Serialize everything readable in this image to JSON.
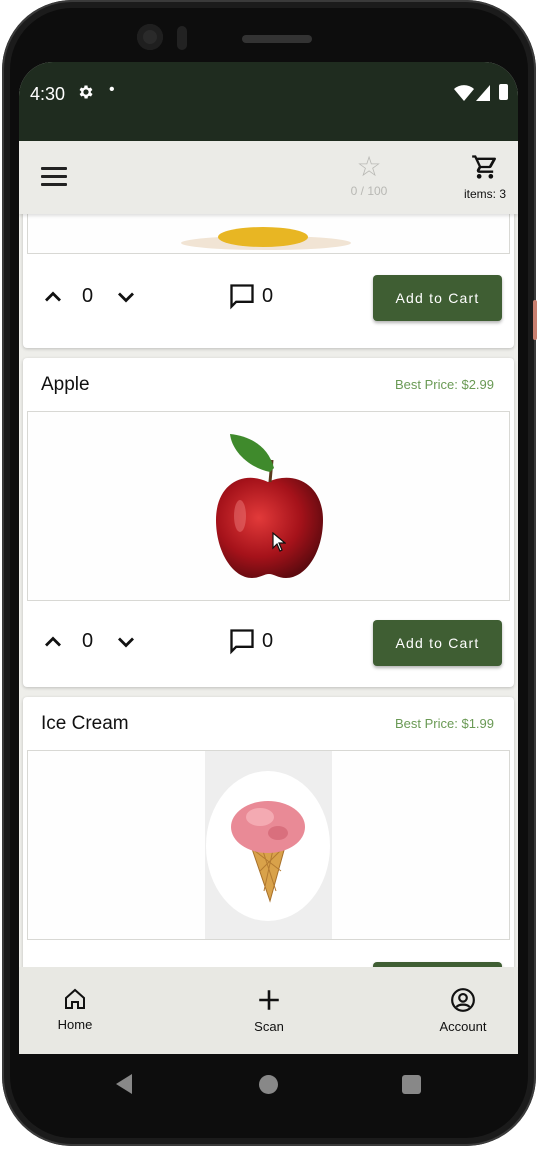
{
  "status_bar": {
    "time": "4:30",
    "gear_icon": "gear-icon",
    "dot": "•"
  },
  "app_bar": {
    "stars_label": "0 / 100",
    "cart_label": "items: 3"
  },
  "products": [
    {
      "quantity": "0",
      "comments": "0",
      "add_label": "Add to Cart"
    },
    {
      "name": "Apple",
      "best_price": "Best Price: $2.99",
      "quantity": "0",
      "comments": "0",
      "add_label": "Add to Cart"
    },
    {
      "name": "Ice Cream",
      "best_price": "Best Price: $1.99"
    }
  ],
  "bottom_nav": {
    "home": "Home",
    "scan": "Scan",
    "account": "Account"
  },
  "colors": {
    "accent": "#3f5e33",
    "price": "#6a9a55",
    "status_bar": "#1f2c1f"
  }
}
